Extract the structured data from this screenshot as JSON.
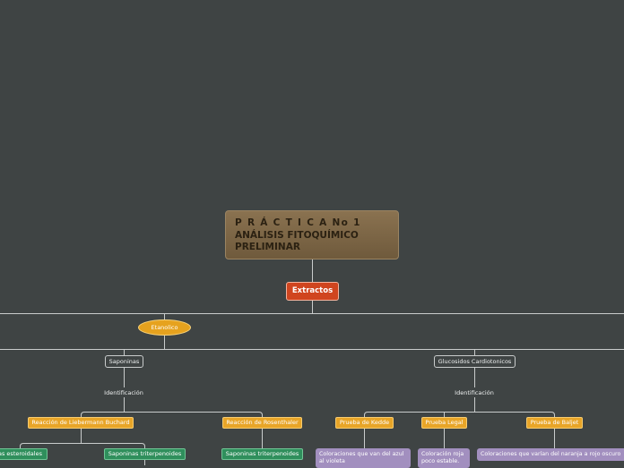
{
  "colors": {
    "background": "#3f4444",
    "root": "#7a6446",
    "extractos": "#d0451f",
    "etanolico": "#e6a21e",
    "reaction": "#e8a528",
    "saponina_type": "#2f8f5c",
    "coloration": "#a28fbf",
    "line": "#c9cccc"
  },
  "nodes": {
    "root_line1": "P R Á C T I C A No 1",
    "root_line2": "ANÁLISIS FITOQUÍMICO PRELIMINAR",
    "extractos": "Extractos",
    "etanolico": "Etanolico",
    "saponinas": "Saponinas",
    "glucosidos": "Glucosidos Cardiotonicos",
    "identificacion_left": "Identificación",
    "identificacion_right": "Identificación",
    "liebermann": "Reacción de Liebermann Buchard",
    "rosenthaler": "Reacción de Rosenthaler",
    "kedde": "Prueba de Kedde",
    "legal": "Prueba Legal",
    "baljet": "Prueba de Baljet",
    "sap_esteroidales": "as esteroidales",
    "sap_triterpenoides_1": "Saponinas triterpenoides",
    "sap_triterpenoides_2": "Saponinas triterpenoides",
    "color_azul_violeta": "Coloraciones que van del azul al violeta",
    "color_rojo": "Coloración roja poco estable.",
    "color_naranja": "Coloraciones que varían del naranja a rojo oscuro"
  }
}
